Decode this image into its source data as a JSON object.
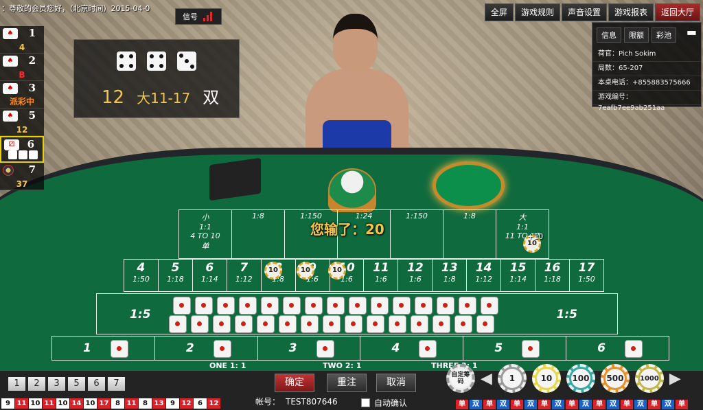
{
  "ticker": "：尊敬的会员您好，（北京时间）2015-04-0",
  "signal_label": "信号",
  "top_buttons": [
    "全屏",
    "游戏规则",
    "声音设置",
    "游戏报表",
    "返回大厅"
  ],
  "left_panel": [
    {
      "num": "1",
      "sub": "4"
    },
    {
      "num": "2",
      "sub": "B"
    },
    {
      "num": "3",
      "sub": "派彩中"
    },
    {
      "num": "5",
      "sub": "12"
    },
    {
      "num": "6",
      "sub": ""
    },
    {
      "num": "7",
      "sub": "37"
    }
  ],
  "result": {
    "dice": [
      4,
      4,
      3
    ],
    "total": "12",
    "big_small": "大11-17",
    "odd_even": "双"
  },
  "info_panel": {
    "tabs": [
      "信息",
      "限额",
      "彩池"
    ],
    "rows": [
      "荷官：Pich Sokim",
      "局数：65-207",
      "本桌电话：+855883575666",
      "游戏编号：7eafb7ee9ab251aa"
    ]
  },
  "table": {
    "top_cells": [
      "小",
      "1:8",
      "1:150",
      "1:24",
      "1:150",
      "1:8",
      "大"
    ],
    "small_text": [
      "1:1",
      "4 TO 10",
      "单"
    ],
    "big_text": [
      "1:1",
      "11 TO 17"
    ],
    "numbers": [
      {
        "n": "4",
        "odds": "1:50"
      },
      {
        "n": "5",
        "odds": "1:18"
      },
      {
        "n": "6",
        "odds": "1:14"
      },
      {
        "n": "7",
        "odds": "1:12"
      },
      {
        "n": "8",
        "odds": "1:8"
      },
      {
        "n": "9",
        "odds": "1:6"
      },
      {
        "n": "10",
        "odds": "1:6"
      },
      {
        "n": "11",
        "odds": "1:6"
      },
      {
        "n": "12",
        "odds": "1:6"
      },
      {
        "n": "13",
        "odds": "1:8"
      },
      {
        "n": "14",
        "odds": "1:12"
      },
      {
        "n": "15",
        "odds": "1:14"
      },
      {
        "n": "16",
        "odds": "1:18"
      },
      {
        "n": "17",
        "odds": "1:50"
      }
    ],
    "pair_odds_left": "1:5",
    "pair_odds_right": "1:5",
    "singles": [
      "1",
      "2",
      "3",
      "4",
      "5",
      "6"
    ],
    "pay_one": "ONE 1: 1",
    "pay_two": "TWO 2: 1",
    "pay_three": "THREE 3: 1",
    "placed_chip": "10",
    "plus_chip": "+10"
  },
  "lost_message": "您输了：20",
  "bottom": {
    "pages": [
      "1",
      "2",
      "3",
      "5",
      "6",
      "7"
    ],
    "confirm": "确定",
    "rebet": "重注",
    "cancel": "取消",
    "account_label": "帐号：",
    "account_value": "TEST807646",
    "auto_confirm": "自动确认",
    "custom_chip": "自定筹码",
    "chips": [
      "1",
      "10",
      "100",
      "500",
      "1000"
    ],
    "history": [
      "9",
      "11",
      "10",
      "11",
      "10",
      "14",
      "10",
      "17",
      "8",
      "11",
      "8",
      "13",
      "9",
      "12",
      "6",
      "12"
    ],
    "history_colors": [
      "w",
      "r",
      "w",
      "r",
      "w",
      "r",
      "w",
      "r",
      "w",
      "r",
      "w",
      "r",
      "w",
      "r",
      "w",
      "r"
    ],
    "odd_even": [
      "单",
      "双",
      "单",
      "双",
      "单",
      "双",
      "单",
      "双",
      "单",
      "双",
      "单",
      "双",
      "单",
      "双",
      "单",
      "双",
      "单"
    ],
    "odd_even_colors": [
      "r",
      "b",
      "r",
      "b",
      "r",
      "b",
      "r",
      "b",
      "r",
      "b",
      "r",
      "b",
      "r",
      "b",
      "r",
      "b",
      "r"
    ]
  }
}
